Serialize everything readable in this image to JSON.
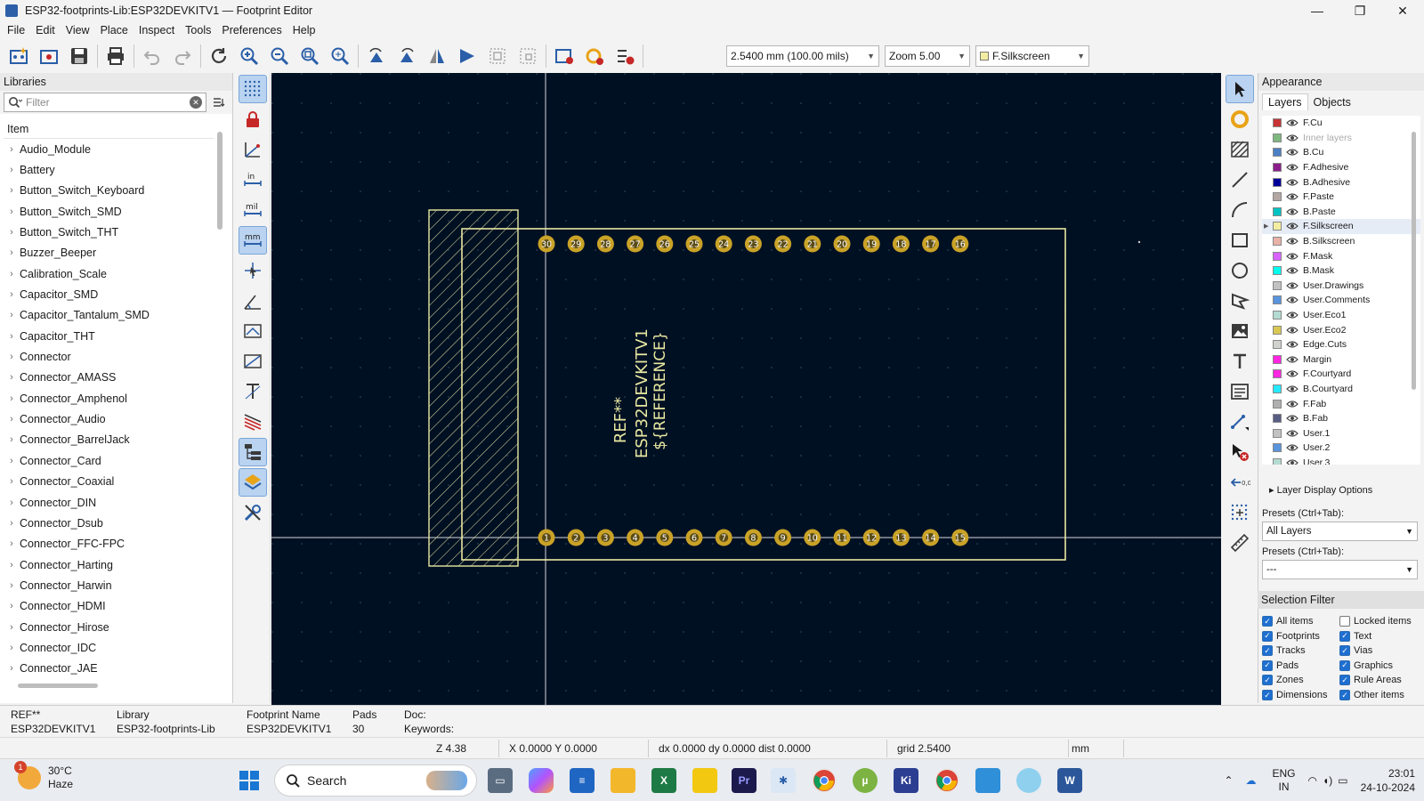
{
  "window": {
    "title": "ESP32-footprints-Lib:ESP32DEVKITV1 — Footprint Editor",
    "controls": [
      "—",
      "❐",
      "✕"
    ]
  },
  "menu": [
    "File",
    "Edit",
    "View",
    "Place",
    "Inspect",
    "Tools",
    "Preferences",
    "Help"
  ],
  "toolbar": {
    "grid_select": "2.5400 mm (100.00 mils)",
    "zoom_select": "Zoom 5.00",
    "layer_select": "F.Silkscreen"
  },
  "libraries": {
    "header": "Libraries",
    "filter_placeholder": "Filter",
    "column": "Item",
    "items": [
      "Audio_Module",
      "Battery",
      "Button_Switch_Keyboard",
      "Button_Switch_SMD",
      "Button_Switch_THT",
      "Buzzer_Beeper",
      "Calibration_Scale",
      "Capacitor_SMD",
      "Capacitor_Tantalum_SMD",
      "Capacitor_THT",
      "Connector",
      "Connector_AMASS",
      "Connector_Amphenol",
      "Connector_Audio",
      "Connector_BarrelJack",
      "Connector_Card",
      "Connector_Coaxial",
      "Connector_DIN",
      "Connector_Dsub",
      "Connector_FFC-FPC",
      "Connector_Harting",
      "Connector_Harwin",
      "Connector_HDMI",
      "Connector_Hirose",
      "Connector_IDC",
      "Connector_JAE"
    ]
  },
  "canvas": {
    "ref_text": "REF**",
    "value_text": "ESP32DEVKITV1",
    "ref_field_text": "${REFERENCE}",
    "top_pads": [
      "30",
      "29",
      "28",
      "27",
      "26",
      "25",
      "24",
      "23",
      "22",
      "21",
      "20",
      "19",
      "18",
      "17",
      "16"
    ],
    "bottom_pads": [
      "1",
      "2",
      "3",
      "4",
      "5",
      "6",
      "7",
      "8",
      "9",
      "10",
      "11",
      "12",
      "13",
      "14",
      "15"
    ],
    "colors": {
      "background": "#001023",
      "silkscreen": "#e8e8a0",
      "pad": "#c9a227",
      "crosshair": "#d8d8d8"
    }
  },
  "appearance": {
    "header": "Appearance",
    "tabs": [
      "Layers",
      "Objects"
    ],
    "layers": [
      {
        "name": "F.Cu",
        "color": "#c83434"
      },
      {
        "name": "Inner layers",
        "color": "#7fb87f",
        "dim": true
      },
      {
        "name": "B.Cu",
        "color": "#4d7fc4"
      },
      {
        "name": "F.Adhesive",
        "color": "#8b1e8b"
      },
      {
        "name": "B.Adhesive",
        "color": "#000099"
      },
      {
        "name": "F.Paste",
        "color": "#b4a7a3"
      },
      {
        "name": "B.Paste",
        "color": "#00c2c2"
      },
      {
        "name": "F.Silkscreen",
        "color": "#f2eda1",
        "selected": true
      },
      {
        "name": "B.Silkscreen",
        "color": "#e8b2a7"
      },
      {
        "name": "F.Mask",
        "color": "#d864ff"
      },
      {
        "name": "B.Mask",
        "color": "#02ffee"
      },
      {
        "name": "User.Drawings",
        "color": "#c2c2c2"
      },
      {
        "name": "User.Comments",
        "color": "#5994dc"
      },
      {
        "name": "User.Eco1",
        "color": "#b4dbd2"
      },
      {
        "name": "User.Eco2",
        "color": "#d8c852"
      },
      {
        "name": "Edge.Cuts",
        "color": "#d0d2cd"
      },
      {
        "name": "Margin",
        "color": "#ff26e2"
      },
      {
        "name": "F.Courtyard",
        "color": "#ff26e2"
      },
      {
        "name": "B.Courtyard",
        "color": "#26e9ff"
      },
      {
        "name": "F.Fab",
        "color": "#afafaf"
      },
      {
        "name": "B.Fab",
        "color": "#585d84"
      },
      {
        "name": "User.1",
        "color": "#c2c2c2"
      },
      {
        "name": "User.2",
        "color": "#5994dc"
      },
      {
        "name": "User.3",
        "color": "#b4dbd2"
      }
    ],
    "layer_display_options": "Layer Display Options",
    "presets_label_1": "Presets (Ctrl+Tab):",
    "presets_value_1": "All Layers",
    "presets_label_2": "Presets (Ctrl+Tab):",
    "presets_value_2": "---"
  },
  "selection_filter": {
    "header": "Selection Filter",
    "items": [
      {
        "label": "All items",
        "checked": true
      },
      {
        "label": "Locked items",
        "checked": false
      },
      {
        "label": "Footprints",
        "checked": true
      },
      {
        "label": "Text",
        "checked": true
      },
      {
        "label": "Tracks",
        "checked": true
      },
      {
        "label": "Vias",
        "checked": true
      },
      {
        "label": "Pads",
        "checked": true
      },
      {
        "label": "Graphics",
        "checked": true
      },
      {
        "label": "Zones",
        "checked": true
      },
      {
        "label": "Rule Areas",
        "checked": true
      },
      {
        "label": "Dimensions",
        "checked": true
      },
      {
        "label": "Other items",
        "checked": true
      }
    ]
  },
  "message_panel": {
    "ref": "REF**",
    "value": "ESP32DEVKITV1",
    "library_label": "Library",
    "library_value": "ESP32-footprints-Lib",
    "fpname_label": "Footprint Name",
    "fpname_value": "ESP32DEVKITV1",
    "pads_label": "Pads",
    "pads_value": "30",
    "doc_label": "Doc:",
    "keywords_label": "Keywords:"
  },
  "status": {
    "z": "Z 4.38",
    "xy": "X 0.0000  Y 0.0000",
    "delta": "dx 0.0000  dy 0.0000  dist 0.0000",
    "grid": "grid 2.5400",
    "units": "mm"
  },
  "taskbar": {
    "weather_badge": "1",
    "temperature": "30°C",
    "condition": "Haze",
    "search": "Search",
    "language_1": "ENG",
    "language_2": "IN",
    "time": "23:01",
    "date": "24-10-2024"
  }
}
